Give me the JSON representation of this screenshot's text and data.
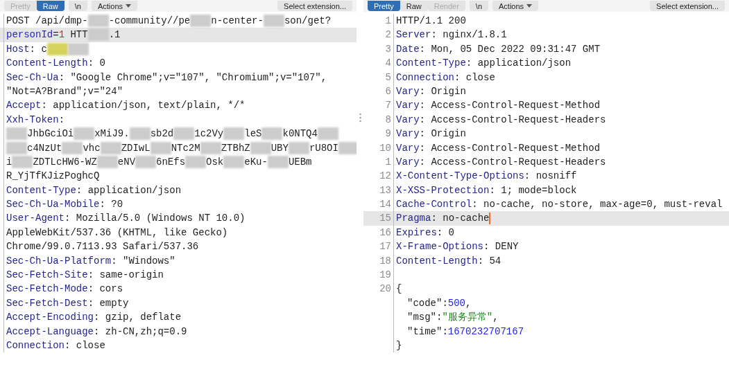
{
  "request": {
    "toolbar": {
      "tabs": [
        {
          "label": "Pretty",
          "selected": false,
          "disabled": true
        },
        {
          "label": "Raw",
          "selected": true,
          "disabled": false
        }
      ],
      "buttons": [
        {
          "label": "\\n",
          "kind": "plain"
        },
        {
          "label": "Actions",
          "kind": "menu"
        }
      ],
      "extension": "Select extension..."
    },
    "lines": [
      {
        "kind": "parts",
        "selected": false,
        "parts": [
          {
            "kind": "text",
            "text": "POST /api/dmp-"
          },
          {
            "kind": "redacted",
            "color": "#cccccc"
          },
          {
            "kind": "text",
            "text": "-community//pe"
          },
          {
            "kind": "redacted",
            "color": "#cccccc"
          },
          {
            "kind": "text",
            "text": "n-center-"
          },
          {
            "kind": "redacted",
            "color": "#cccccc"
          },
          {
            "kind": "text",
            "text": "son/get?"
          }
        ]
      },
      {
        "kind": "parts",
        "selected": true,
        "parts": [
          {
            "kind": "param",
            "text": "personId"
          },
          {
            "kind": "text",
            "text": "="
          },
          {
            "kind": "number",
            "text": "1"
          },
          {
            "kind": "text",
            "text": " HTT"
          },
          {
            "kind": "redacted",
            "color": "#cccccc"
          },
          {
            "kind": "text",
            "text": ".1"
          }
        ]
      },
      {
        "kind": "parts",
        "selected": false,
        "parts": [
          {
            "kind": "name",
            "text": "Host"
          },
          {
            "kind": "text",
            "text": ": c"
          },
          {
            "kind": "redacted",
            "color": "#d6d35c"
          },
          {
            "kind": "redacted",
            "color": "#cccccc"
          }
        ]
      },
      {
        "kind": "header",
        "name": "Content-Length",
        "value": ": 0"
      },
      {
        "kind": "header",
        "name": "Sec-Ch-Ua",
        "value": ": \"Google Chrome\";v=\"107\", \"Chromium\";v=\"107\","
      },
      {
        "kind": "text",
        "text": "\"Not=A?Brand\";v=\"24\""
      },
      {
        "kind": "header",
        "name": "Accept",
        "value": ": application/json, text/plain, */*"
      },
      {
        "kind": "header",
        "name": "Xxh-Token",
        "value": ":"
      },
      {
        "kind": "parts",
        "selected": false,
        "parts": [
          {
            "kind": "redacted",
            "color": "#cccccc"
          },
          {
            "kind": "text",
            "text": "JhbGciOi"
          },
          {
            "kind": "redacted",
            "color": "#cccccc"
          },
          {
            "kind": "text",
            "text": "xMiJ9."
          },
          {
            "kind": "redacted",
            "color": "#cccccc"
          },
          {
            "kind": "text",
            "text": "sb2d"
          },
          {
            "kind": "redacted",
            "color": "#cccccc"
          },
          {
            "kind": "text",
            "text": "1c2Vy"
          },
          {
            "kind": "redacted",
            "color": "#cccccc"
          },
          {
            "kind": "text",
            "text": "leS"
          },
          {
            "kind": "redacted",
            "color": "#cccccc"
          },
          {
            "kind": "text",
            "text": "k0NTQ4"
          },
          {
            "kind": "redacted",
            "color": "#cccccc"
          }
        ]
      },
      {
        "kind": "parts",
        "selected": false,
        "parts": [
          {
            "kind": "redacted",
            "color": "#cccccc"
          },
          {
            "kind": "text",
            "text": "c4NzUt"
          },
          {
            "kind": "redacted",
            "color": "#cccccc"
          },
          {
            "kind": "text",
            "text": "vhc"
          },
          {
            "kind": "redacted",
            "color": "#cccccc"
          },
          {
            "kind": "text",
            "text": "ZDIwL"
          },
          {
            "kind": "redacted",
            "color": "#cccccc"
          },
          {
            "kind": "text",
            "text": "NTc2M"
          },
          {
            "kind": "redacted",
            "color": "#cccccc"
          },
          {
            "kind": "text",
            "text": "ZTBhZ"
          },
          {
            "kind": "redacted",
            "color": "#cccccc"
          },
          {
            "kind": "text",
            "text": "UBY"
          },
          {
            "kind": "redacted",
            "color": "#cccccc"
          },
          {
            "kind": "text",
            "text": "rU8OI"
          },
          {
            "kind": "redacted",
            "color": "#cccccc"
          }
        ]
      },
      {
        "kind": "parts",
        "selected": false,
        "parts": [
          {
            "kind": "text",
            "text": "i"
          },
          {
            "kind": "redacted",
            "color": "#cccccc"
          },
          {
            "kind": "text",
            "text": "ZDTLcHW6-WZ"
          },
          {
            "kind": "redacted",
            "color": "#cccccc"
          },
          {
            "kind": "text",
            "text": "eNV"
          },
          {
            "kind": "redacted",
            "color": "#cccccc"
          },
          {
            "kind": "text",
            "text": "6nEfs"
          },
          {
            "kind": "redacted",
            "color": "#cccccc"
          },
          {
            "kind": "text",
            "text": "Osk"
          },
          {
            "kind": "redacted",
            "color": "#cccccc"
          },
          {
            "kind": "text",
            "text": "eKu-"
          },
          {
            "kind": "redacted",
            "color": "#cccccc"
          },
          {
            "kind": "text",
            "text": "UEBm"
          }
        ]
      },
      {
        "kind": "text",
        "text": "R_YjTfKJizPoghcQ"
      },
      {
        "kind": "header",
        "name": "Content-Type",
        "value": ": application/json"
      },
      {
        "kind": "header",
        "name": "Sec-Ch-Ua-Mobile",
        "value": ": ?0"
      },
      {
        "kind": "header",
        "name": "User-Agent",
        "value": ": Mozilla/5.0 (Windows NT 10.0)"
      },
      {
        "kind": "text",
        "text": "AppleWebKit/537.36 (KHTML, like Gecko)"
      },
      {
        "kind": "text",
        "text": "Chrome/99.0.7113.93 Safari/537.36"
      },
      {
        "kind": "header",
        "name": "Sec-Ch-Ua-Platform",
        "value": ": \"Windows\""
      },
      {
        "kind": "header",
        "name": "Sec-Fetch-Site",
        "value": ": same-origin"
      },
      {
        "kind": "header",
        "name": "Sec-Fetch-Mode",
        "value": ": cors"
      },
      {
        "kind": "header",
        "name": "Sec-Fetch-Dest",
        "value": ": empty"
      },
      {
        "kind": "header",
        "name": "Accept-Encoding",
        "value": ": gzip, deflate"
      },
      {
        "kind": "header",
        "name": "Accept-Language",
        "value": ": zh-CN,zh;q=0.9"
      },
      {
        "kind": "header",
        "name": "Connection",
        "value": ": close"
      }
    ]
  },
  "response": {
    "toolbar": {
      "tabs": [
        {
          "label": "Pretty",
          "selected": true,
          "disabled": false
        },
        {
          "label": "Raw",
          "selected": false,
          "disabled": false
        },
        {
          "label": "Render",
          "selected": false,
          "disabled": true
        }
      ],
      "buttons": [
        {
          "label": "\\n",
          "kind": "plain"
        },
        {
          "label": "Actions",
          "kind": "menu"
        }
      ],
      "extension": "Select extension..."
    },
    "lines": [
      {
        "number": "1",
        "kind": "text",
        "text": "HTTP/1.1 200",
        "selected": false
      },
      {
        "number": "2",
        "kind": "header",
        "name": "Server",
        "value": ": nginx/1.8.1",
        "selected": false
      },
      {
        "number": "3",
        "kind": "header",
        "name": "Date",
        "value": ": Mon, 05 Dec 2022 09:31:47 GMT",
        "selected": false
      },
      {
        "number": "4",
        "kind": "header",
        "name": "Content-Type",
        "value": ": application/json",
        "selected": false
      },
      {
        "number": "5",
        "kind": "header",
        "name": "Connection",
        "value": ": close",
        "selected": false
      },
      {
        "number": "6",
        "kind": "header",
        "name": "Vary",
        "value": ": Origin",
        "selected": false
      },
      {
        "number": "7",
        "kind": "header",
        "name": "Vary",
        "value": ": Access-Control-Request-Method",
        "selected": false
      },
      {
        "number": "8",
        "kind": "header",
        "name": "Vary",
        "value": ": Access-Control-Request-Headers",
        "selected": false
      },
      {
        "number": "9",
        "kind": "header",
        "name": "Vary",
        "value": ": Origin",
        "selected": false
      },
      {
        "number": "10",
        "kind": "header",
        "name": "Vary",
        "value": ": Access-Control-Request-Method",
        "selected": false
      },
      {
        "number": "1",
        "kind": "header",
        "name": "Vary",
        "value": ": Access-Control-Request-Headers",
        "selected": false
      },
      {
        "number": "12",
        "kind": "header",
        "name": "X-Content-Type-Options",
        "value": ": nosniff",
        "selected": false
      },
      {
        "number": "13",
        "kind": "header",
        "name": "X-XSS-Protection",
        "value": ": 1; mode=block",
        "selected": false
      },
      {
        "number": "14",
        "kind": "header",
        "name": "Cache-Control",
        "value": ": no-cache, no-store, max-age=0, must-reval",
        "selected": false
      },
      {
        "number": "15",
        "kind": "header",
        "name": "Pragma",
        "value": ": no-cache",
        "selected": true
      },
      {
        "number": "16",
        "kind": "header",
        "name": "Expires",
        "value": ": 0",
        "selected": false
      },
      {
        "number": "17",
        "kind": "header",
        "name": "X-Frame-Options",
        "value": ": DENY",
        "selected": false
      },
      {
        "number": "18",
        "kind": "header",
        "name": "Content-Length",
        "value": ": 54",
        "selected": false
      },
      {
        "number": "19",
        "kind": "blank",
        "selected": false
      },
      {
        "number": "20",
        "kind": "text",
        "text": "{",
        "selected": false
      },
      {
        "kind": "json",
        "key": "\"code\":",
        "value": "500",
        "color": "#1f1fe6",
        "trail": ",",
        "selected": false
      },
      {
        "kind": "json",
        "key": "\"msg\":",
        "value": "\"服务异常\"",
        "color": "#1a8a1a",
        "trail": ",",
        "selected": false
      },
      {
        "kind": "json",
        "key": "\"time\":",
        "value": "1670232707167",
        "color": "#1f1fe6",
        "selected": false
      },
      {
        "kind": "text",
        "text": "}",
        "selected": false
      }
    ]
  }
}
